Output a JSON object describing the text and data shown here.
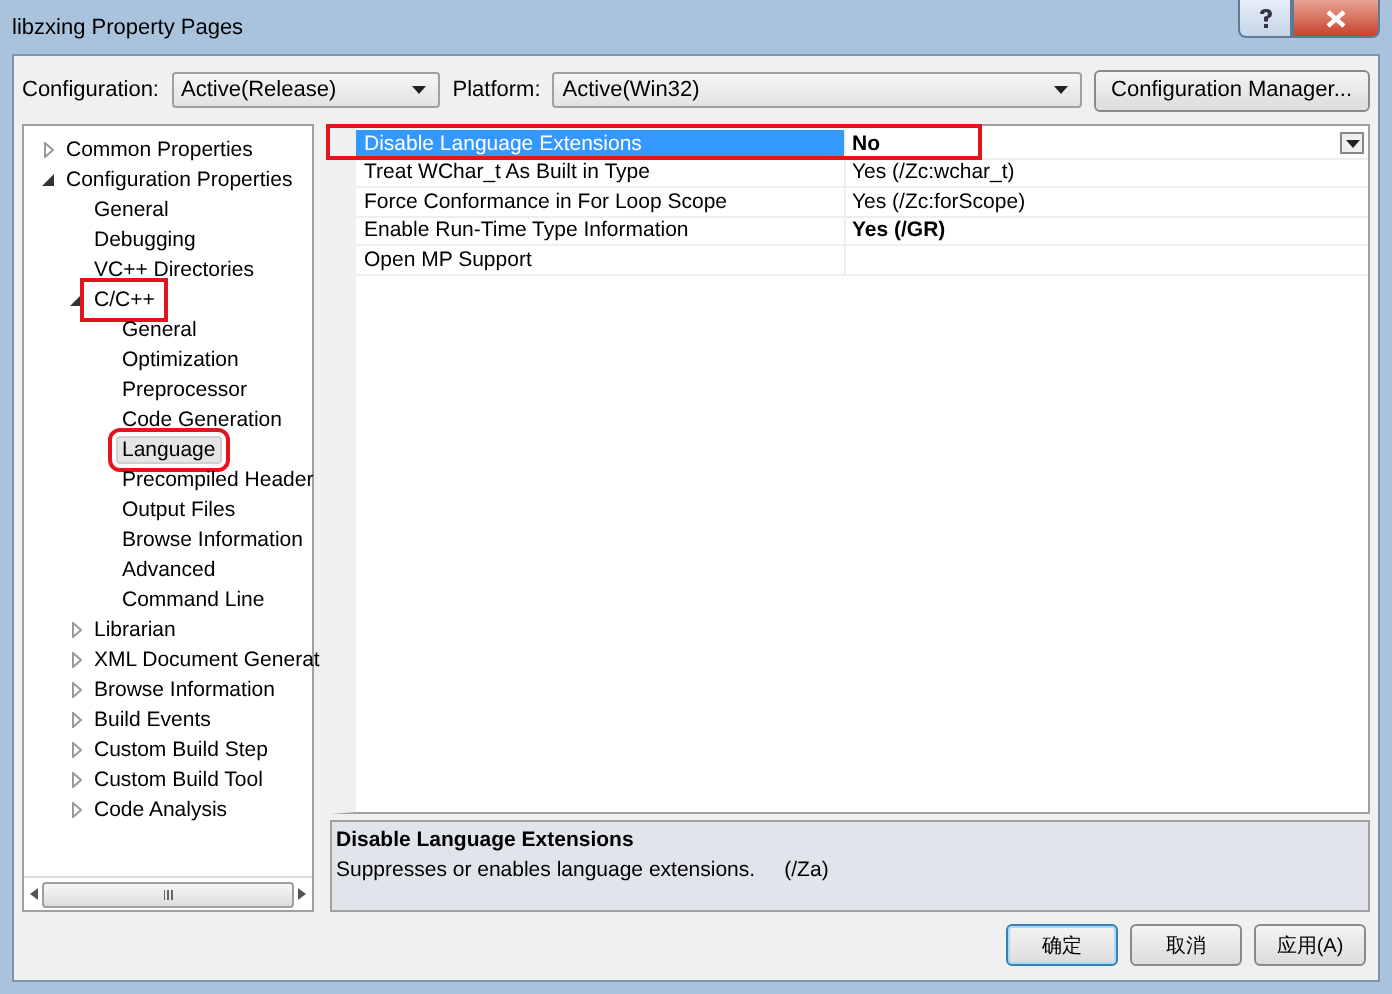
{
  "window": {
    "title": "libzxing Property Pages"
  },
  "toolbar": {
    "configuration": {
      "label": "Configuration:",
      "value": "Active(Release)"
    },
    "platform": {
      "label": "Platform:",
      "value": "Active(Win32)"
    },
    "manager_button": "Configuration Manager..."
  },
  "tree": [
    {
      "label": "Common Properties",
      "expanded": false,
      "selected": false,
      "annotated": false
    },
    {
      "label": "Configuration Properties",
      "expanded": true,
      "selected": false,
      "annotated": false,
      "children": [
        {
          "label": "General",
          "selected": false,
          "annotated": false
        },
        {
          "label": "Debugging",
          "selected": false,
          "annotated": false
        },
        {
          "label": "VC++ Directories",
          "selected": false,
          "annotated": false
        },
        {
          "label": "C/C++",
          "expanded": true,
          "selected": false,
          "annotated": true,
          "children": [
            {
              "label": "General",
              "selected": false,
              "annotated": false
            },
            {
              "label": "Optimization",
              "selected": false,
              "annotated": false
            },
            {
              "label": "Preprocessor",
              "selected": false,
              "annotated": false
            },
            {
              "label": "Code Generation",
              "selected": false,
              "annotated": false
            },
            {
              "label": "Language",
              "selected": true,
              "annotated": true
            },
            {
              "label": "Precompiled Header",
              "selected": false,
              "annotated": false
            },
            {
              "label": "Output Files",
              "selected": false,
              "annotated": false
            },
            {
              "label": "Browse Information",
              "selected": false,
              "annotated": false
            },
            {
              "label": "Advanced",
              "selected": false,
              "annotated": false
            },
            {
              "label": "Command Line",
              "selected": false,
              "annotated": false
            }
          ]
        },
        {
          "label": "Librarian",
          "expanded": false,
          "selected": false,
          "annotated": false
        },
        {
          "label": "XML Document Generat",
          "expanded": false,
          "selected": false,
          "annotated": false
        },
        {
          "label": "Browse Information",
          "expanded": false,
          "selected": false,
          "annotated": false
        },
        {
          "label": "Build Events",
          "expanded": false,
          "selected": false,
          "annotated": false
        },
        {
          "label": "Custom Build Step",
          "expanded": false,
          "selected": false,
          "annotated": false
        },
        {
          "label": "Custom Build Tool",
          "expanded": false,
          "selected": false,
          "annotated": false
        },
        {
          "label": "Code Analysis",
          "expanded": false,
          "selected": false,
          "annotated": false
        }
      ]
    }
  ],
  "properties": [
    {
      "name": "Disable Language Extensions",
      "value": "No",
      "selected": true,
      "modified": true,
      "annotated": true
    },
    {
      "name": "Treat WChar_t As Built in Type",
      "value": "Yes (/Zc:wchar_t)",
      "selected": false,
      "modified": false,
      "annotated": false
    },
    {
      "name": "Force Conformance in For Loop Scope",
      "value": "Yes (/Zc:forScope)",
      "selected": false,
      "modified": false,
      "annotated": false
    },
    {
      "name": "Enable Run-Time Type Information",
      "value": "Yes (/GR)",
      "selected": false,
      "modified": true,
      "annotated": false
    },
    {
      "name": "Open MP Support",
      "selected": false,
      "annotated": false
    }
  ],
  "description": {
    "title": "Disable Language Extensions",
    "text": "Suppresses or enables language extensions.     (/Za)"
  },
  "buttons": [
    {
      "label": "确定",
      "default": true
    },
    {
      "label": "取消",
      "default": false
    },
    {
      "label": "应用(A)",
      "default": false
    }
  ]
}
